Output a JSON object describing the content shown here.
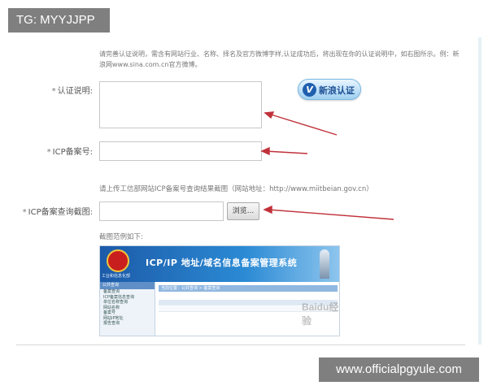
{
  "tag": {
    "text": "TG: MYYJJPP"
  },
  "watermark": {
    "text": "www.officialpgyule.com"
  },
  "hint": {
    "text": "请完善认证说明，需含有网站行业、名称、择名及官方微博字样,认证成功后，将出现在你的认证说明中，如右图所示。例：新浪网www.sina.com.cn官方微博。"
  },
  "form": {
    "required_mark": "*",
    "desc_label": "认证说明:",
    "icp_label": "ICP备案号:",
    "shot_label": "ICP备案查询截图:",
    "desc_value": "",
    "icp_value": "",
    "file_value": "",
    "browse_label": "浏览..."
  },
  "sina_button": {
    "v": "V",
    "label": "新浪认证"
  },
  "hint2": {
    "text": "请上传工信部网站ICP备案号查询结果截图（网站地址：http://www.miitbeian.gov.cn）"
  },
  "example": {
    "label": "截图范例如下:",
    "banner_title": "ICP/IP 地址/域名信息备案管理系统",
    "emblem_caption": "工业和信息化部",
    "side_header": "公共查询",
    "side_items": [
      "备案查询",
      "ICP备案信息查询",
      "单位名称查询",
      "网站名称",
      "备案号",
      "网站IP地址",
      "报告查询"
    ],
    "bar_text": "当前位置：公共查询 > 备案查询",
    "watermark": "Baidu经验"
  },
  "colors": {
    "accent": "#1d4f94",
    "arrow": "#c0313a",
    "tag_bg": "#7f7f7f"
  }
}
